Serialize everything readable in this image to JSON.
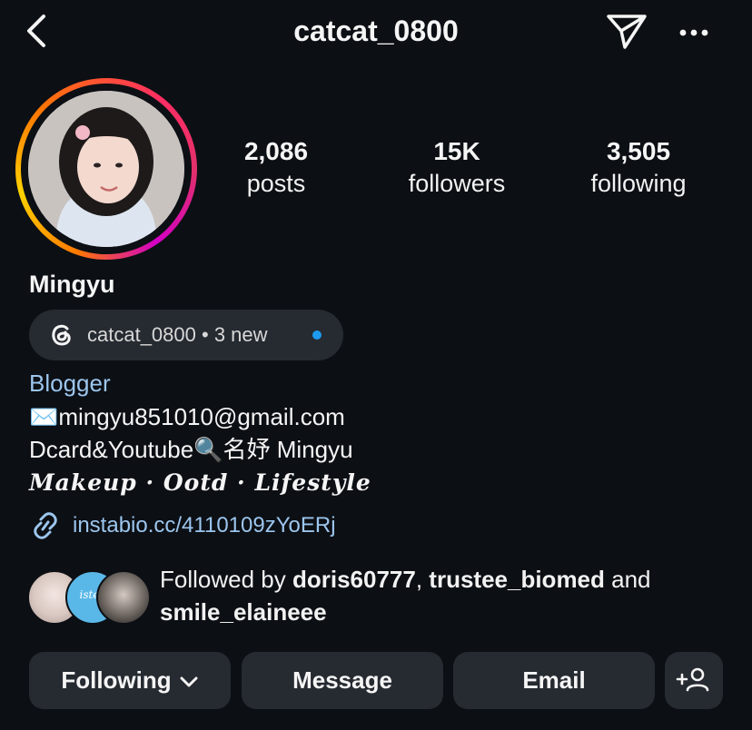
{
  "header": {
    "username": "catcat_0800",
    "icons": {
      "back": "chevron-left-icon",
      "send": "paper-plane-icon",
      "more": "more-horizontal-icon"
    }
  },
  "profile": {
    "avatar": "profile-photo",
    "stats": [
      {
        "value": "2,086",
        "label": "posts"
      },
      {
        "value": "15K",
        "label": "followers"
      },
      {
        "value": "3,505",
        "label": "following"
      }
    ],
    "name": "Mingyu",
    "threads": {
      "handle": "catcat_0800",
      "separator": "•",
      "new_label": "3 new",
      "dot_color": "#1d9bf0"
    },
    "bio": {
      "category": "Blogger",
      "email_line": "✉️mingyu851010@gmail.com",
      "line2": "Dcard&Youtube🔍名妤 Mingyu",
      "line3": "Makeup · Ootd · Lifestyle",
      "link": "instabio.cc/4110109zYoERj"
    },
    "followed_by": {
      "prefix": "Followed by ",
      "user1": "doris60777",
      "sep1": ", ",
      "user2": "trustee_biomed",
      "conj": " and ",
      "user3": "smile_elaineee",
      "avatar2_text": "istee"
    }
  },
  "actions": {
    "following": "Following",
    "message": "Message",
    "email": "Email",
    "add_icon": "add-person-icon"
  },
  "colors": {
    "background": "#0c0f14",
    "button_bg": "#262a31",
    "link": "#9cc6ee"
  }
}
